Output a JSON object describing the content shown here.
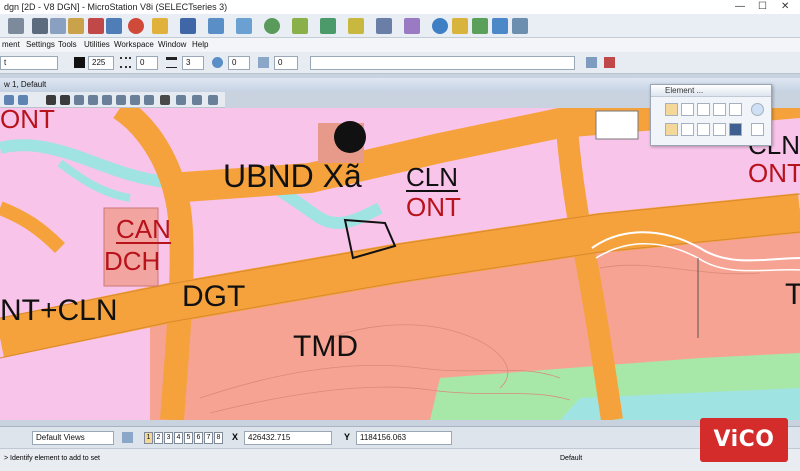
{
  "window": {
    "title": "dgn [2D - V8 DGN] - MicroStation V8i (SELECTseries 3)"
  },
  "menu": [
    "ment",
    "Settings",
    "Tools",
    "Utilities",
    "Workspace",
    "Window",
    "Help"
  ],
  "attributes": {
    "level": "t",
    "color_value": "225",
    "style_value": "0",
    "weight_value": "3",
    "transparency_value": "0",
    "priority_value": "0",
    "color_swatch": "#111111"
  },
  "view": {
    "title": "w 1, Default"
  },
  "map": {
    "labels": {
      "ont_top_left": "ONT",
      "ubnd": "UBND Xã",
      "cln": "CLN",
      "ont_center": "ONT",
      "can": "CAN",
      "dch": "DCH",
      "dgt": "DGT",
      "ont_cln": "NT+CLN",
      "tmd": "TMD",
      "cln_right": "CLN",
      "ont_right": "ONT",
      "right_edge": "T"
    },
    "colors": {
      "residential": "#f9c4ea",
      "road": "#f5a23c",
      "commercial": "#f6a393",
      "water": "#9fe3e3",
      "green": "#a7e8a8",
      "label_black": "#111111",
      "label_red": "#b8121b"
    }
  },
  "palette": {
    "title": "Element ..."
  },
  "status": {
    "views_label": "Default Views",
    "view_buttons": [
      "1",
      "2",
      "3",
      "4",
      "5",
      "6",
      "7",
      "8"
    ],
    "x_label": "X",
    "x_value": "426432.715",
    "y_label": "Y",
    "y_value": "1184156.063",
    "prompt": "> Identify element to add to set",
    "model": "Default"
  },
  "watermark": "ViCO"
}
